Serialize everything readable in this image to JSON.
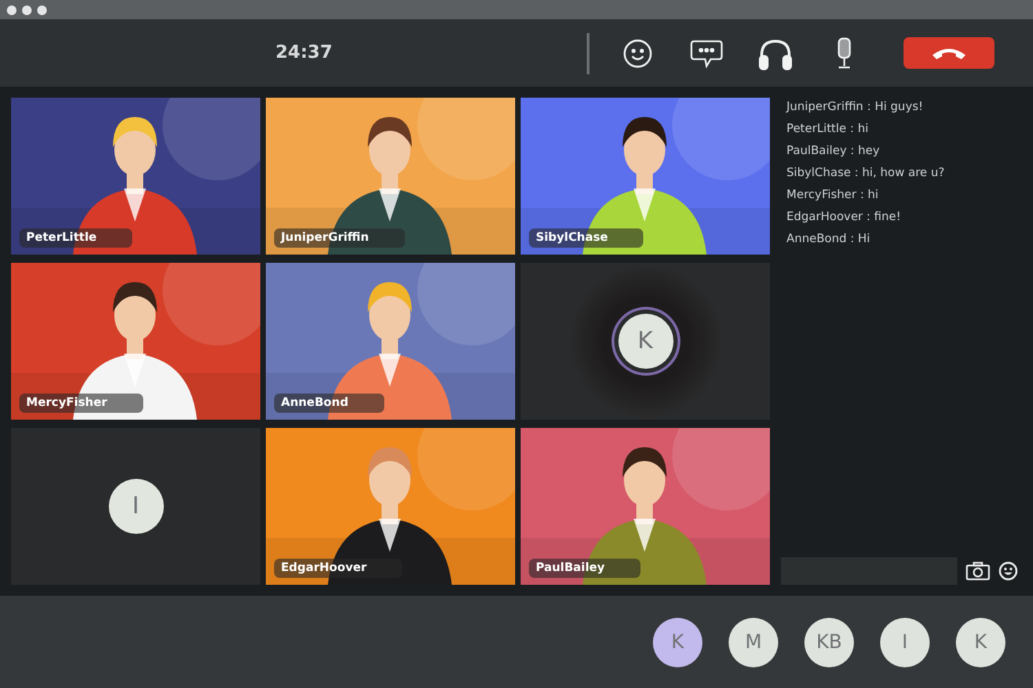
{
  "call": {
    "timer": "24:37"
  },
  "tiles": [
    {
      "kind": "picture",
      "name": "PeterLittle"
    },
    {
      "kind": "picture",
      "name": "JuniperGriffin"
    },
    {
      "kind": "picture",
      "name": "SibylChase"
    },
    {
      "kind": "picture",
      "name": "MercyFisher"
    },
    {
      "kind": "picture",
      "name": "AnneBond"
    },
    {
      "kind": "avatar",
      "initial": "K",
      "speaking": true
    },
    {
      "kind": "avatar",
      "initial": "I",
      "speaking": false
    },
    {
      "kind": "picture",
      "name": "EdgarHoover"
    },
    {
      "kind": "picture",
      "name": "PaulBailey"
    }
  ],
  "chat": {
    "messages": [
      "JuniperGriffin : Hi guys!",
      "PeterLittle : hi",
      "PaulBailey : hey",
      "SibylChase : hi, how are u?",
      "MercyFisher : hi",
      "EdgarHoover : fine!",
      "AnneBond : Hi"
    ]
  },
  "participants": [
    {
      "initial": "K",
      "speaking": true
    },
    {
      "initial": "M",
      "speaking": false
    },
    {
      "initial": "KB",
      "speaking": false
    },
    {
      "initial": "I",
      "speaking": false
    },
    {
      "initial": "K",
      "speaking": false
    }
  ]
}
